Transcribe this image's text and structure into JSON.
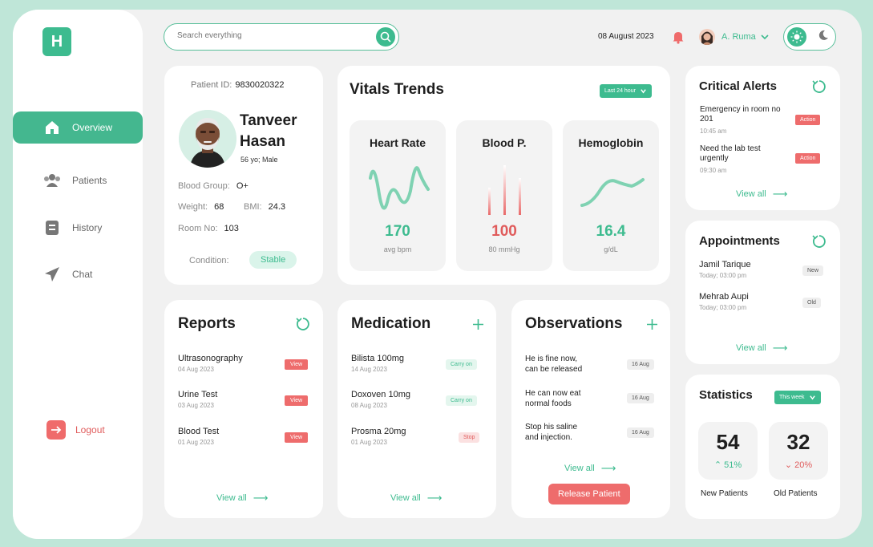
{
  "app": {
    "logo_letter": "H"
  },
  "sidebar": {
    "items": [
      {
        "label": "Overview",
        "icon": "home-icon",
        "active": true
      },
      {
        "label": "Patients",
        "icon": "users-icon"
      },
      {
        "label": "History",
        "icon": "document-icon"
      },
      {
        "label": "Chat",
        "icon": "paper-plane-icon"
      }
    ],
    "logout_label": "Logout"
  },
  "header": {
    "search_placeholder": "Search everything",
    "date": "08 August 2023",
    "user_name": "A. Ruma"
  },
  "patient": {
    "id_label": "Patient ID:",
    "id_value": "9830020322",
    "first_name": "Tanveer",
    "last_name": "Hasan",
    "age_sex": "56 yo; Male",
    "blood_group_label": "Blood Group:",
    "blood_group": "O+",
    "weight_label": "Weight:",
    "weight": "68",
    "bmi_label": "BMI:",
    "bmi": "24.3",
    "room_label": "Room No:",
    "room": "103",
    "condition_label": "Condition:",
    "condition": "Stable"
  },
  "vitals": {
    "title": "Vitals Trends",
    "range": "Last 24 hour",
    "cards": [
      {
        "title": "Heart Rate",
        "value": "170",
        "unit": "avg bpm",
        "color": "#3dbb8f"
      },
      {
        "title": "Blood P.",
        "value": "100",
        "unit": "80 mmHg",
        "color": "#e05b5b"
      },
      {
        "title": "Hemoglobin",
        "value": "16.4",
        "unit": "g/dL",
        "color": "#3dbb8f"
      }
    ]
  },
  "alerts": {
    "title": "Critical Alerts",
    "items": [
      {
        "text": "Emergency in room no 201",
        "time": "10:45 am",
        "action": "Action"
      },
      {
        "text": "Need the lab test urgently",
        "time": "09:30 am",
        "action": "Action"
      }
    ],
    "view_all": "View all"
  },
  "appointments": {
    "title": "Appointments",
    "items": [
      {
        "name": "Jamil Tarique",
        "time": "Today; 03:00 pm",
        "tag": "New"
      },
      {
        "name": "Mehrab Aupi",
        "time": "Today; 03:00 pm",
        "tag": "Old"
      }
    ],
    "view_all": "View all"
  },
  "statistics": {
    "title": "Statistics",
    "range": "This week",
    "new_value": "54",
    "new_change": "51%",
    "new_label": "New Patients",
    "old_value": "32",
    "old_change": "20%",
    "old_label": "Old Patients"
  },
  "reports": {
    "title": "Reports",
    "items": [
      {
        "name": "Ultrasonography",
        "date": "04 Aug 2023",
        "action": "View"
      },
      {
        "name": "Urine Test",
        "date": "03 Aug 2023",
        "action": "View"
      },
      {
        "name": "Blood Test",
        "date": "01 Aug 2023",
        "action": "View"
      }
    ],
    "view_all": "View all"
  },
  "medication": {
    "title": "Medication",
    "items": [
      {
        "name": "Bilista 100mg",
        "date": "14 Aug 2023",
        "status": "Carry on"
      },
      {
        "name": "Doxoven 10mg",
        "date": "08 Aug 2023",
        "status": "Carry on"
      },
      {
        "name": "Prosma 20mg",
        "date": "01 Aug 2023",
        "status": "Stop"
      }
    ],
    "view_all": "View all"
  },
  "observations": {
    "title": "Observations",
    "items": [
      {
        "line1": "He is fine now,",
        "line2": "can  be released",
        "date": "16 Aug"
      },
      {
        "line1": "He can now eat",
        "line2": "normal foods",
        "date": "16 Aug"
      },
      {
        "line1": "Stop his saline",
        "line2": "and injection.",
        "date": "16 Aug"
      }
    ],
    "view_all": "View all",
    "release_label": "Release Patient"
  }
}
